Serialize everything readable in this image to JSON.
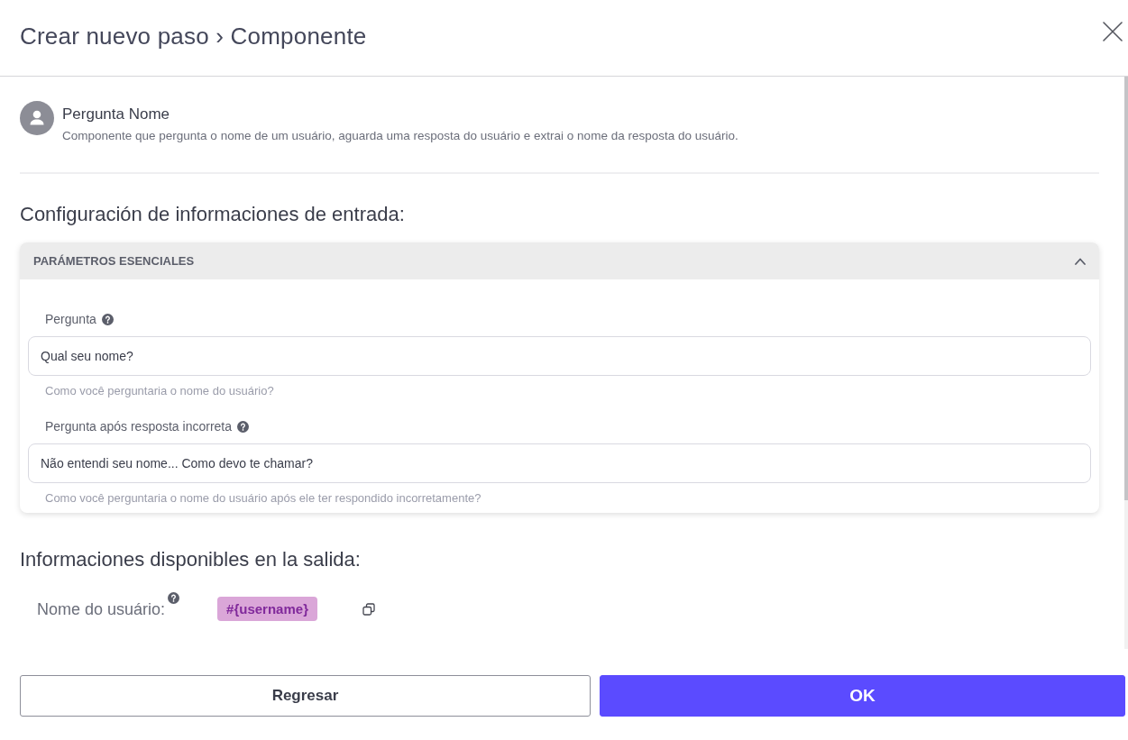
{
  "dialog": {
    "title": "Crear nuevo paso › Componente"
  },
  "component": {
    "name": "Pergunta Nome",
    "description": "Componente que pergunta o nome de um usuário, aguarda uma resposta do usuário e extrai o nome da resposta do usuário."
  },
  "input_section": {
    "title": "Configuración de informaciones de entrada:",
    "accordion": {
      "title": "PARÁMETROS ESENCIALES",
      "expanded": true,
      "fields": [
        {
          "label": "Pergunta",
          "value": "Qual seu nome?",
          "hint": "Como você perguntaria o nome do usuário?"
        },
        {
          "label": "Pergunta após resposta incorreta",
          "value": "Não entendi seu nome... Como devo te chamar?",
          "hint": "Como você perguntaria o nome do usuário após ele ter respondido incorretamente?"
        }
      ]
    }
  },
  "output_section": {
    "title": "Informaciones disponibles en la salida:",
    "variables": [
      {
        "label": "Nome do usuário:",
        "token": "#{username}"
      }
    ]
  },
  "buttons": [
    {
      "label": "Regresar",
      "kind": "secondary"
    },
    {
      "label": "OK",
      "kind": "primary"
    }
  ]
}
